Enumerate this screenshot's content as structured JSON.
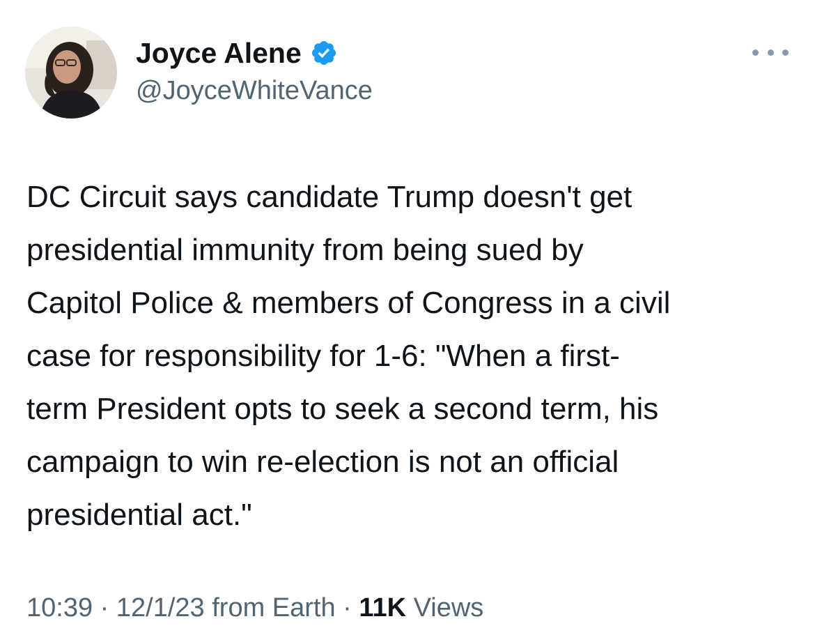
{
  "author": {
    "display_name": "Joyce Alene",
    "handle": "@JoyceWhiteVance",
    "verified": true,
    "verified_color": "#1d9bf0"
  },
  "icons": {
    "verified": "verified-badge-icon",
    "more": "more-options-icon"
  },
  "tweet": {
    "text_lines": [
      "DC Circuit says candidate Trump doesn't get",
      "presidential immunity from being sued by",
      "Capitol Police & members of Congress in a civil",
      "case for responsibility for 1-6:  \"When a first-",
      "term President opts to seek a second term, his",
      "campaign to win re-election is not an official",
      "presidential act.\""
    ]
  },
  "meta": {
    "time": "10:39",
    "separator": " · ",
    "date": "12/1/23",
    "source": " from Earth",
    "separator2": " · ",
    "views_count": "11K",
    "views_label": " Views"
  }
}
